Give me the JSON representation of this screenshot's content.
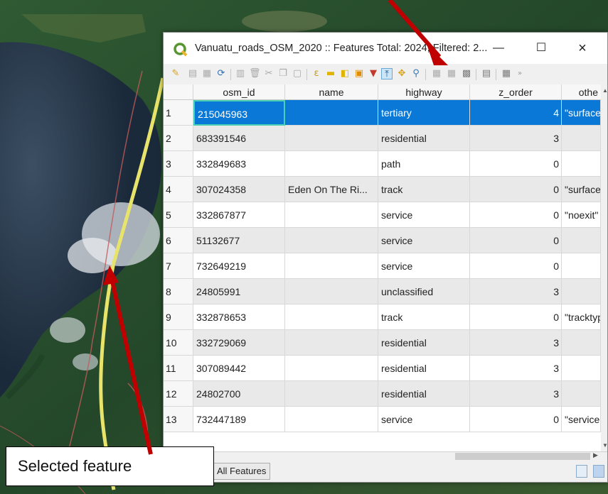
{
  "window": {
    "title": "Vanuatu_roads_OSM_2020 :: Features Total: 2024, Filtered: 2...",
    "minimize": "—",
    "maximize": "☐",
    "close": "×"
  },
  "table": {
    "columns": [
      "osm_id",
      "name",
      "highway",
      "z_order",
      "othe"
    ],
    "rows": [
      {
        "n": "1",
        "osm_id": "215045963",
        "name": "",
        "highway": "tertiary",
        "z_order": "4",
        "other": "\"surface"
      },
      {
        "n": "2",
        "osm_id": "683391546",
        "name": "",
        "highway": "residential",
        "z_order": "3",
        "other": ""
      },
      {
        "n": "3",
        "osm_id": "332849683",
        "name": "",
        "highway": "path",
        "z_order": "0",
        "other": ""
      },
      {
        "n": "4",
        "osm_id": "307024358",
        "name": "Eden On The Ri...",
        "highway": "track",
        "z_order": "0",
        "other": "\"surface"
      },
      {
        "n": "5",
        "osm_id": "332867877",
        "name": "",
        "highway": "service",
        "z_order": "0",
        "other": "\"noexit\""
      },
      {
        "n": "6",
        "osm_id": "51132677",
        "name": "",
        "highway": "service",
        "z_order": "0",
        "other": ""
      },
      {
        "n": "7",
        "osm_id": "732649219",
        "name": "",
        "highway": "service",
        "z_order": "0",
        "other": ""
      },
      {
        "n": "8",
        "osm_id": "24805991",
        "name": "",
        "highway": "unclassified",
        "z_order": "3",
        "other": ""
      },
      {
        "n": "9",
        "osm_id": "332878653",
        "name": "",
        "highway": "track",
        "z_order": "0",
        "other": "\"tracktyp"
      },
      {
        "n": "10",
        "osm_id": "332729069",
        "name": "",
        "highway": "residential",
        "z_order": "3",
        "other": ""
      },
      {
        "n": "11",
        "osm_id": "307089442",
        "name": "",
        "highway": "residential",
        "z_order": "3",
        "other": ""
      },
      {
        "n": "12",
        "osm_id": "24802700",
        "name": "",
        "highway": "residential",
        "z_order": "3",
        "other": ""
      },
      {
        "n": "13",
        "osm_id": "732447189",
        "name": "",
        "highway": "service",
        "z_order": "0",
        "other": "\"service"
      }
    ],
    "selected_row": "1"
  },
  "bottom": {
    "filter_label": "All Features"
  },
  "annotation": {
    "callout": "Selected feature"
  },
  "colors": {
    "selection": "#0a78d7",
    "arrow": "#c00000",
    "current_cell_border": "#48d0b4"
  }
}
